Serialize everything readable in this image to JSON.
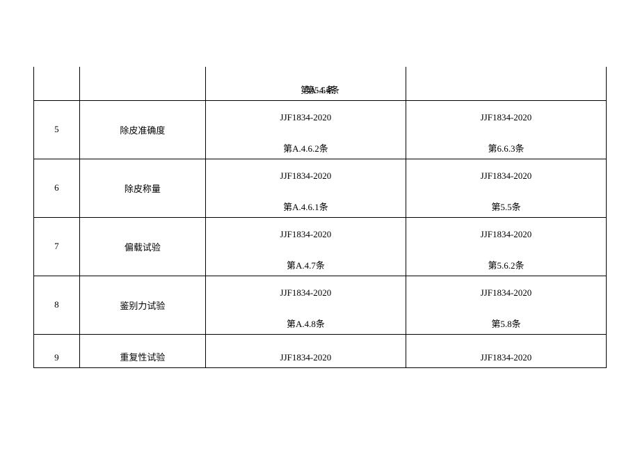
{
  "table": {
    "headerFragment": {
      "col3_line2": "第A·4.4条",
      "col4_line2": "第5.5条"
    },
    "rows": [
      {
        "num": "5",
        "name": "除皮准确度",
        "col3_line1": "JJF1834-2020",
        "col3_line2": "第A.4.6.2条",
        "col4_line1": "JJF1834-2020",
        "col4_line2": "第6.6.3条"
      },
      {
        "num": "6",
        "name": "除皮称量",
        "col3_line1": "JJF1834-2020",
        "col3_line2": "第A.4.6.1条",
        "col4_line1": "JJF1834-2020",
        "col4_line2": "第5.5条"
      },
      {
        "num": "7",
        "name": "偏载试验",
        "col3_line1": "JJF1834-2020",
        "col3_line2": "第A.4.7条",
        "col4_line1": "JJF1834-2020",
        "col4_line2": "第5.6.2条"
      },
      {
        "num": "8",
        "name": "鉴别力试验",
        "col3_line1": "JJF1834-2020",
        "col3_line2": "第A.4.8条",
        "col4_line1": "JJF1834-2020",
        "col4_line2": "第5.8条"
      }
    ],
    "lastRow": {
      "num": "9",
      "name": "重复性试验",
      "col3_line1": "JJF1834-2020",
      "col4_line1": "JJF1834-2020"
    }
  }
}
